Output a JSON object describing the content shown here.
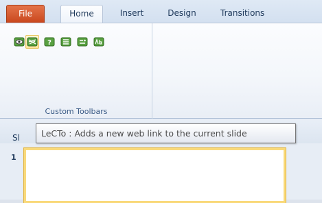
{
  "tabs": {
    "file": "File",
    "home": "Home",
    "insert": "Insert",
    "design": "Design",
    "transitions": "Transitions"
  },
  "ribbon": {
    "group_label": "Custom Toolbars",
    "buttons": [
      {
        "icon": "eye-toolbar-icon"
      },
      {
        "icon": "web-link-icon",
        "state": "hover"
      },
      {
        "icon": "help-icon"
      },
      {
        "icon": "list-icon"
      },
      {
        "icon": "tag-icon"
      },
      {
        "icon": "abc-icon"
      }
    ]
  },
  "pane": {
    "slides_tab_label": "Sl",
    "slide_number": "1"
  },
  "tooltip": {
    "text": "LeCTo : Adds a new web link to the current slide"
  },
  "colors": {
    "file_tab": "#c9471d",
    "hover": "#ffe39a",
    "selection": "#f9d97a"
  }
}
